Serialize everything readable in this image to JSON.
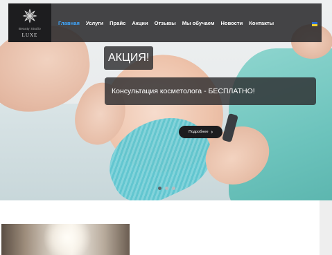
{
  "header": {
    "logo": {
      "brand": "Beauty Studio",
      "sub": "LUXE",
      "icon": "flower-logo-icon"
    },
    "nav": [
      {
        "label": "Главная",
        "active": true
      },
      {
        "label": "Услуги",
        "active": false
      },
      {
        "label": "Прайс",
        "active": false
      },
      {
        "label": "Акции",
        "active": false
      },
      {
        "label": "Отзывы",
        "active": false
      },
      {
        "label": "Мы обучаем",
        "active": false
      },
      {
        "label": "Новости",
        "active": false
      },
      {
        "label": "Контакты",
        "active": false
      }
    ],
    "language_flag": "ukraine-flag-icon",
    "accent_color": "#3fa7ff"
  },
  "slider": {
    "title": "АКЦИЯ!",
    "caption": "Консультация косметолога - БЕСПЛАТНО!",
    "button_label": "Подробнее",
    "button_icon": "chevron-right-icon",
    "slide_count": 3,
    "active_slide": 1
  }
}
